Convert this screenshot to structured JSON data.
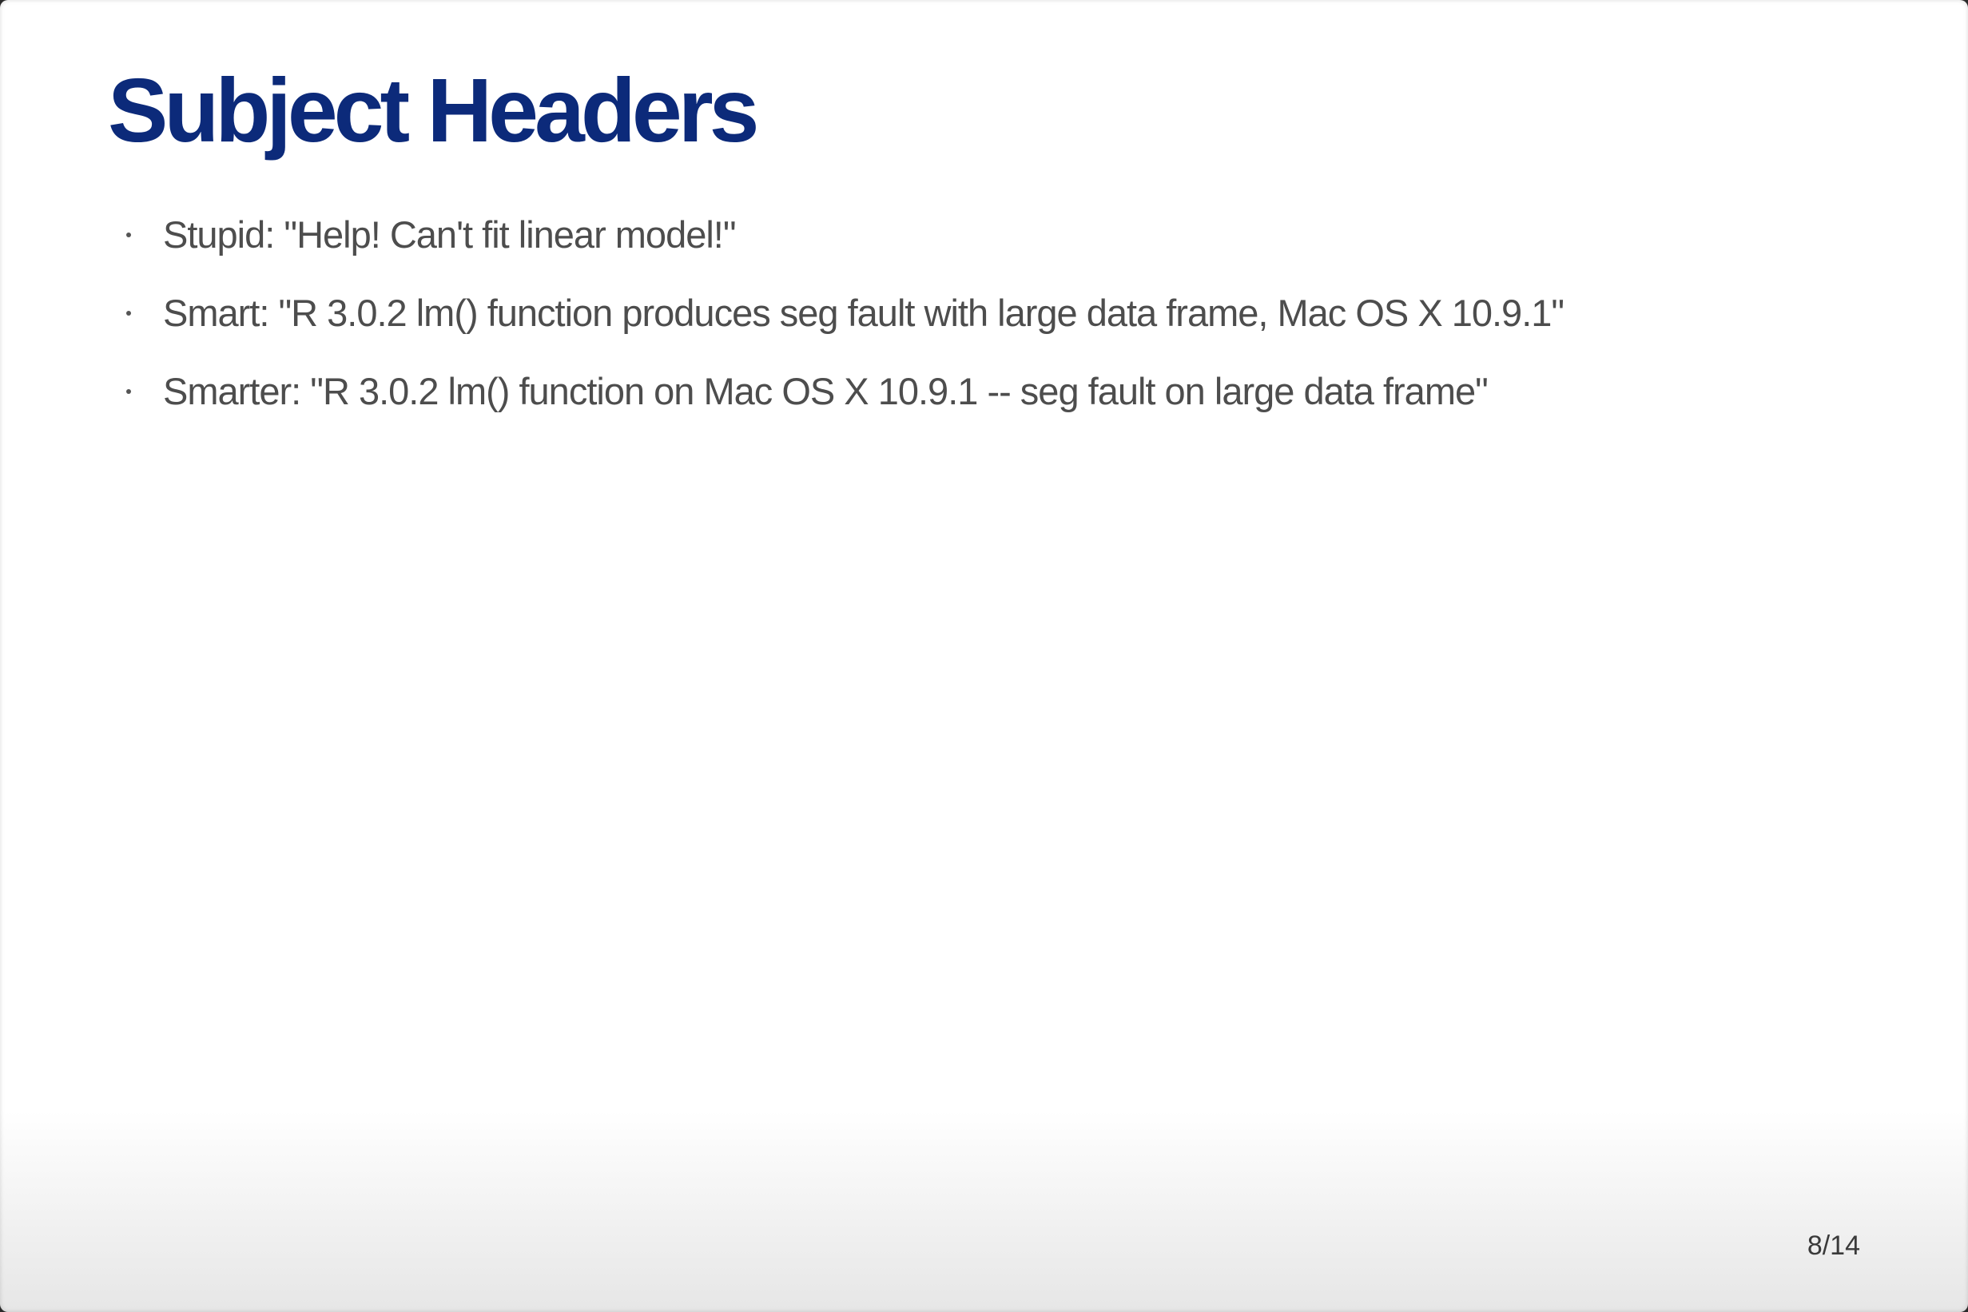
{
  "slide": {
    "title": "Subject Headers",
    "bullets": [
      "Stupid: \"Help! Can't fit linear model!\"",
      "Smart: \"R 3.0.2 lm() function produces seg fault with large data frame, Mac OS X 10.9.1\"",
      "Smarter: \"R 3.0.2 lm() function on Mac OS X 10.9.1 -- seg fault on large data frame\""
    ],
    "page_number": "8/14"
  },
  "colors": {
    "title": "#0c2a7a",
    "body_text": "#4d4d4d",
    "background": "#ffffff"
  }
}
